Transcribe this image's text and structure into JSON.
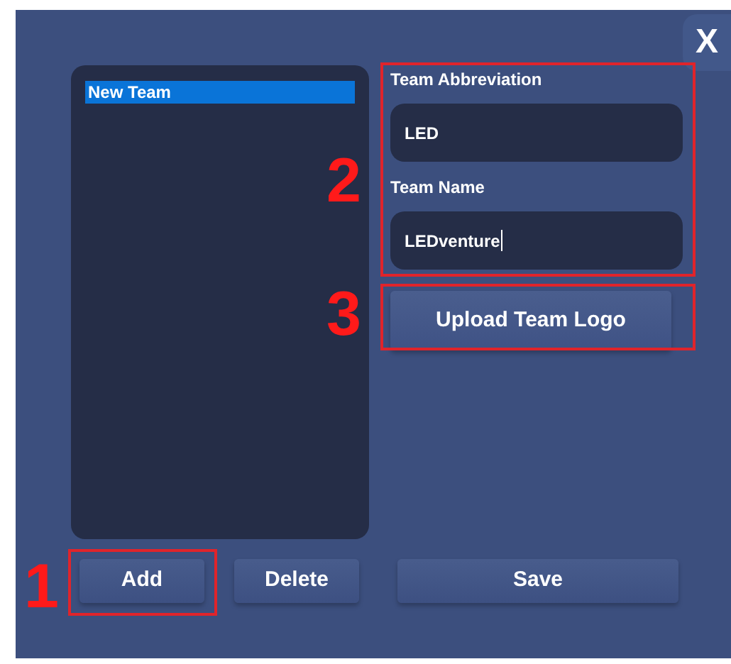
{
  "close_button": {
    "label": "X"
  },
  "team_list": {
    "items": [
      {
        "label": "New Team",
        "selected": true
      }
    ]
  },
  "fields": [
    {
      "label": "Team Abbreviation",
      "value": "LED",
      "focused": false
    },
    {
      "label": "Team Name",
      "value": "LEDventure",
      "focused": true
    }
  ],
  "upload_button": {
    "label": "Upload Team Logo"
  },
  "buttons": [
    {
      "label": "Add",
      "kind": "small"
    },
    {
      "label": "Delete",
      "kind": "small"
    },
    {
      "label": "Save",
      "kind": "wide"
    }
  ],
  "annotations": [
    {
      "label": "1"
    },
    {
      "label": "2"
    },
    {
      "label": "3"
    }
  ]
}
